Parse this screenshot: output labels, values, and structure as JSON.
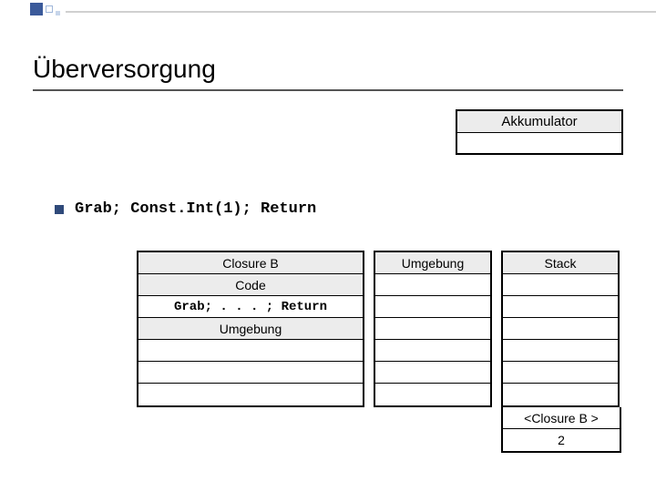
{
  "title": "Überversorgung",
  "akkumulator": {
    "header": "Akkumulator"
  },
  "bullet": {
    "code": "Grab; Const.Int(1); Return"
  },
  "closure": {
    "header": "Closure B",
    "sub1": "Code",
    "codeline": "Grab; . . . ; Return",
    "sub2": "Umgebung"
  },
  "umgebung": {
    "header": "Umgebung"
  },
  "stack": {
    "header": "Stack",
    "entry1": "<Closure B >",
    "entry2": "2"
  }
}
